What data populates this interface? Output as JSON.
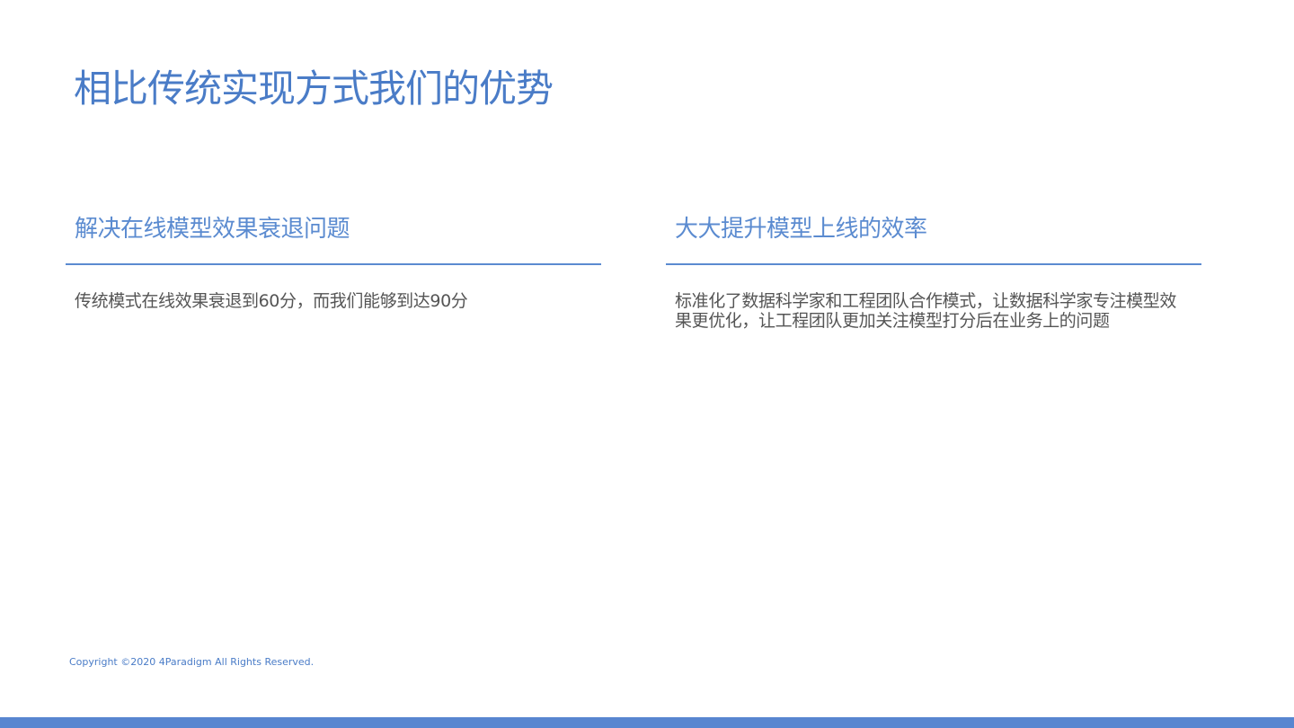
{
  "colors": {
    "accent": "#4a7cc7",
    "heading": "#5b8bd0",
    "divider": "#5b8bd0",
    "body_text": "#555555",
    "bar": "#5886d0"
  },
  "slide": {
    "title": "相比传统实现方式我们的优势"
  },
  "columns": [
    {
      "heading": "解决在线模型效果衰退问题",
      "body": "传统模式在线效果衰退到60分，而我们能够到达90分"
    },
    {
      "heading": "大大提升模型上线的效率",
      "body": "标准化了数据科学家和工程团队合作模式，让数据科学家专注模型效果更优化，让工程团队更加关注模型打分后在业务上的问题"
    }
  ],
  "footer": {
    "copyright": "Copyright ©2020 4Paradigm All Rights Reserved."
  }
}
